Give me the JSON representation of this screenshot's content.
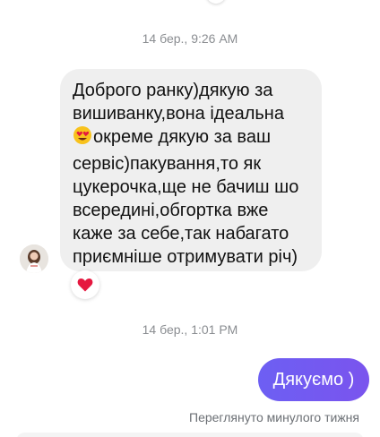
{
  "conversation": {
    "timestamp_1": "14 бер., 9:26 AM",
    "incoming_message": {
      "lines": [
        "Доброго ранку)дякую за",
        "вишиванку,вона ідеальна",
        "окреме дякую за ваш",
        "сервіс)пакування,то як",
        "цукерочка,ще не бачиш шо",
        "всередині,обгортка вже",
        "каже за себе,так набагато",
        "приємніше отримувати річ)"
      ],
      "emoji_icon": "smiling-face-with-heart-eyes-icon",
      "reaction_icon": "red-heart-icon"
    },
    "timestamp_2": "14 бер., 1:01 PM",
    "outgoing_message": "Дякуємо )",
    "seen_status": "Переглянуто минулого тижня"
  },
  "colors": {
    "incoming_bubble": "#efefef",
    "outgoing_bubble": "#7058f1",
    "reaction_heart": "#e5173f",
    "timestamp_text": "#8a8d91"
  }
}
